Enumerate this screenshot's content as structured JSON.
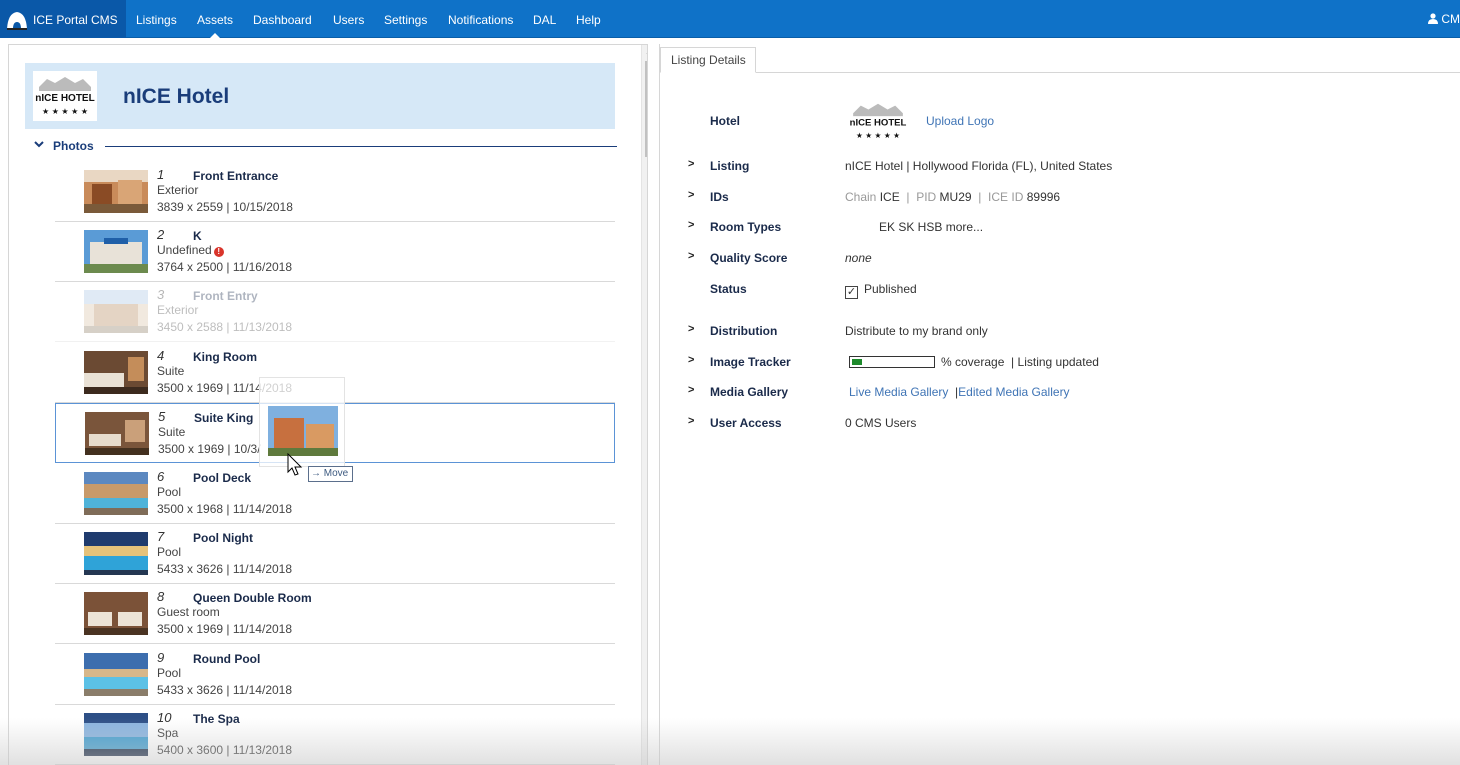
{
  "nav": {
    "brand": "ICE Portal CMS",
    "items": [
      "Listings",
      "Assets",
      "Dashboard",
      "Users",
      "Settings",
      "Notifications",
      "DAL",
      "Help"
    ],
    "active": "Assets",
    "user_label": "CM"
  },
  "hotel": {
    "name": "nICE Hotel",
    "logo_text": "nICE HOTEL"
  },
  "photos_section": {
    "label": "Photos",
    "items": [
      {
        "num": "1",
        "title": "Front Entrance",
        "category": "Exterior",
        "meta": "3839 x 2559 | 10/15/2018"
      },
      {
        "num": "2",
        "title": "K",
        "category": "Undefined",
        "meta": "3764 x 2500 | 11/16/2018"
      },
      {
        "num": "3",
        "title": "Front Entry",
        "category": "Exterior",
        "meta": "3450 x 2588 | 11/13/2018"
      },
      {
        "num": "4",
        "title": "King Room",
        "category": "Suite",
        "meta": "3500 x 1969 | 11/14/2018"
      },
      {
        "num": "5",
        "title": "Suite King",
        "category": "Suite",
        "meta": "3500 x 1969 | 10/3/"
      },
      {
        "num": "6",
        "title": "Pool Deck",
        "category": "Pool",
        "meta": "3500 x 1968 | 11/14/2018"
      },
      {
        "num": "7",
        "title": "Pool Night",
        "category": "Pool",
        "meta": "5433 x 3626 | 11/14/2018"
      },
      {
        "num": "8",
        "title": "Queen Double Room",
        "category": "Guest room",
        "meta": "3500 x 1969 | 11/14/2018"
      },
      {
        "num": "9",
        "title": "Round Pool",
        "category": "Pool",
        "meta": "5433 x 3626 | 11/14/2018"
      },
      {
        "num": "10",
        "title": "The Spa",
        "category": "Spa",
        "meta": "5400 x 3600 | 11/13/2018"
      }
    ],
    "move_tooltip": "Move"
  },
  "details": {
    "tab_label": "Listing Details",
    "hotel_label": "Hotel",
    "upload_logo": "Upload Logo",
    "listing_label": "Listing",
    "listing_value": "nICE Hotel | Hollywood Florida (FL), United States",
    "ids_label": "IDs",
    "ids": {
      "chain_label": "Chain",
      "chain_value": "ICE",
      "pid_label": "PID",
      "pid_value": "MU29",
      "iceid_label": "ICE ID",
      "iceid_value": "89996",
      "sep": "|"
    },
    "room_types_label": "Room Types",
    "room_types_value": "EK SK HSB more...",
    "quality_label": "Quality Score",
    "quality_value": "none",
    "status_label": "Status",
    "status_value": "Published",
    "status_checked": true,
    "distribution_label": "Distribution",
    "distribution_value": "Distribute to my brand only",
    "tracker_label": "Image Tracker",
    "tracker_coverage_fraction": 0.12,
    "tracker_text": "% coverage",
    "tracker_sep": "|",
    "tracker_updated": "Listing updated",
    "media_label": "Media Gallery",
    "media_live": "Live Media Gallery",
    "media_sep": "|",
    "media_edited": "Edited Media Gallery",
    "access_label": "User Access",
    "access_value": "0 CMS Users"
  },
  "colors": {
    "nav_bg": "#0f72c8",
    "brand_bg": "#0a58a8",
    "header_bg": "#d6e8f7",
    "title_color": "#1a3d7a",
    "link": "#3f74b5",
    "progress_fill": "#1e8a2c"
  }
}
